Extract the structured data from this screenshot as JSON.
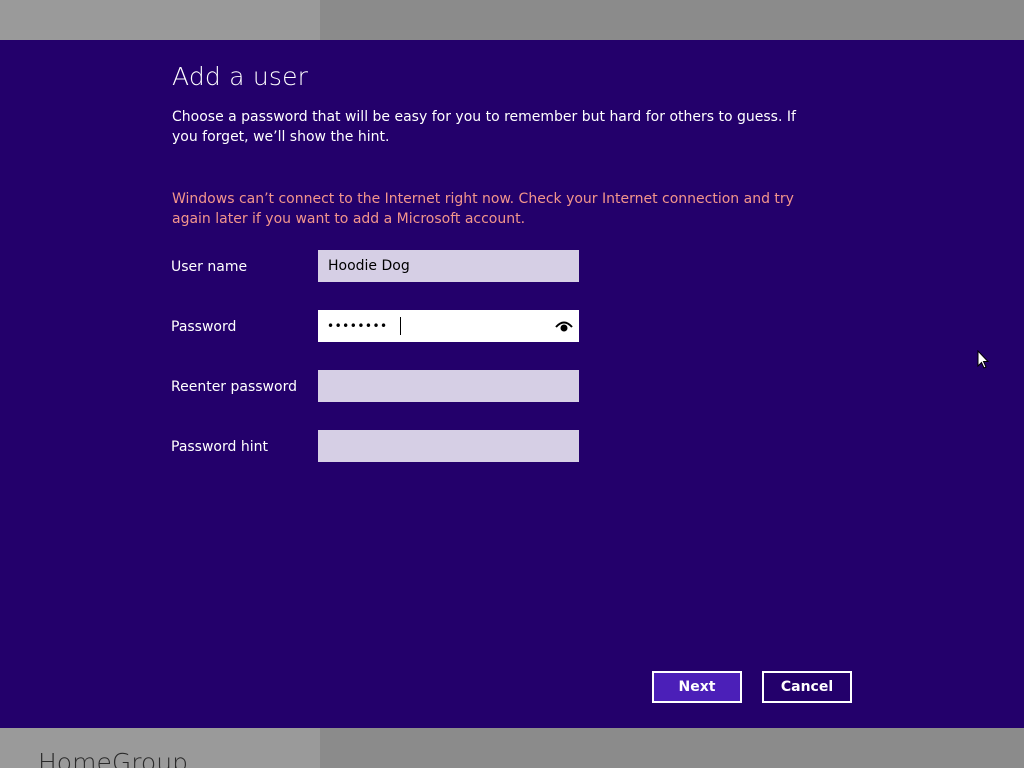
{
  "background": {
    "section_title": "HomeGroup"
  },
  "dialog": {
    "title": "Add a user",
    "instructions": "Choose a password that will be easy for you to remember but hard for others to guess. If you forget, we’ll show the hint.",
    "warning": "Windows can’t connect to the Internet right now. Check your Internet connection and try again later if you want to add a Microsoft account.",
    "fields": {
      "username": {
        "label": "User name",
        "value": "Hoodie Dog"
      },
      "password": {
        "label": "Password",
        "value": "••••••••"
      },
      "reenter_password": {
        "label": "Reenter password",
        "value": ""
      },
      "password_hint": {
        "label": "Password hint",
        "value": ""
      }
    },
    "buttons": {
      "next": "Next",
      "cancel": "Cancel"
    }
  },
  "icons": {
    "reveal_password": "eye-icon",
    "pointer": "mouse-pointer-icon"
  },
  "colors": {
    "dialog_background": "#23006b",
    "warning_text": "#f3958c",
    "input_background": "#d6cfe5",
    "next_button": "#4b1fb8"
  }
}
